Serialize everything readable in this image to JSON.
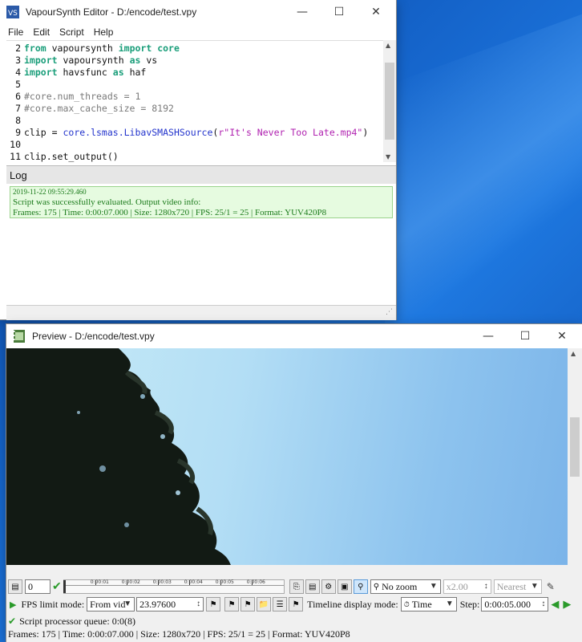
{
  "editor": {
    "title": "VapourSynth Editor - D:/encode/test.vpy",
    "menu": [
      "File",
      "Edit",
      "Script",
      "Help"
    ],
    "code_lines": [
      {
        "num": "2",
        "parts": [
          [
            "kw",
            "from"
          ],
          [
            "id",
            " vapoursynth "
          ],
          [
            "kw",
            "import"
          ],
          [
            "kw",
            " core"
          ]
        ]
      },
      {
        "num": "3",
        "parts": [
          [
            "kw",
            "import"
          ],
          [
            "id",
            " vapoursynth "
          ],
          [
            "kw",
            "as"
          ],
          [
            "id",
            " vs"
          ]
        ]
      },
      {
        "num": "4",
        "parts": [
          [
            "kw",
            "import"
          ],
          [
            "id",
            " havsfunc "
          ],
          [
            "kw",
            "as"
          ],
          [
            "id",
            " haf"
          ]
        ]
      },
      {
        "num": "5",
        "parts": []
      },
      {
        "num": "6",
        "parts": [
          [
            "cm",
            "#core.num_threads = 1"
          ]
        ]
      },
      {
        "num": "7",
        "parts": [
          [
            "cm",
            "#core.max_cache_size = 8192"
          ]
        ]
      },
      {
        "num": "8",
        "parts": []
      },
      {
        "num": "9",
        "parts": [
          [
            "id",
            "clip = "
          ],
          [
            "fn",
            "core.lsmas.LibavSMASHSource"
          ],
          [
            "id",
            "("
          ],
          [
            "st",
            "r\"It's Never Too Late.mp4\""
          ],
          [
            "id",
            ")"
          ]
        ]
      },
      {
        "num": "10",
        "parts": []
      },
      {
        "num": "11",
        "parts": [
          [
            "id",
            "clip.set_output()"
          ]
        ]
      }
    ],
    "log_label": "Log",
    "log": {
      "timestamp": "2019-11-22 09:55:29.460",
      "line1": "Script was successfully evaluated. Output video info:",
      "line2": "Frames: 175 | Time: 0:00:07.000 | Size: 1280x720 | FPS: 25/1 = 25 | Format: YUV420P8"
    }
  },
  "preview": {
    "title": "Preview - D:/encode/test.vpy",
    "frame_value": "0",
    "timeline_labels": [
      "0:00:01",
      "0:00:02",
      "0:00:03",
      "0:00:04",
      "0:00:05",
      "0:00:06"
    ],
    "zoom_mode": "No zoom",
    "zoom_ratio": "x2.00",
    "scale_mode": "Nearest",
    "fps_limit_label": "FPS limit mode:",
    "fps_mode": "From vid",
    "fps_value": "23.97600",
    "timeline_mode_label": "Timeline display mode:",
    "timeline_mode": "Time",
    "step_label": "Step:",
    "step_value": "0:00:05.000",
    "queue_status": "Script processor queue: 0:0(8)",
    "video_info": "Frames: 175 | Time: 0:00:07.000 | Size: 1280x720 | FPS: 25/1 = 25 | Format: YUV420P8"
  }
}
